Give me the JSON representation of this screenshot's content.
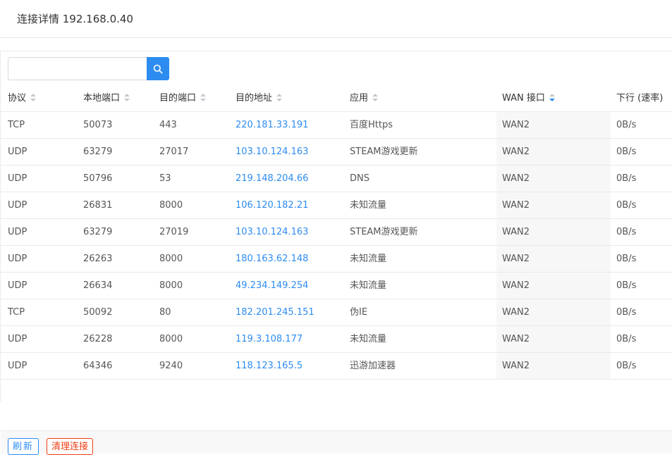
{
  "header": {
    "title": "连接详情 192.168.0.40"
  },
  "search": {
    "placeholder": "",
    "value": "",
    "button_icon": "search-icon"
  },
  "colors": {
    "accent": "#2d8cf0",
    "danger": "#ed3f14"
  },
  "table": {
    "columns": [
      "协议",
      "本地端口",
      "目的端口",
      "目的地址",
      "应用",
      "WAN 接口",
      "下行 (速率)"
    ],
    "sorted_column": "WAN 接口",
    "sort_direction": "descending",
    "rows": [
      [
        "TCP",
        "50073",
        "443",
        "220.181.33.191",
        "百度Https",
        "WAN2",
        "0B/s"
      ],
      [
        "UDP",
        "63279",
        "27017",
        "103.10.124.163",
        "STEAM游戏更新",
        "WAN2",
        "0B/s"
      ],
      [
        "UDP",
        "50796",
        "53",
        "219.148.204.66",
        "DNS",
        "WAN2",
        "0B/s"
      ],
      [
        "UDP",
        "26831",
        "8000",
        "106.120.182.21",
        "未知流量",
        "WAN2",
        "0B/s"
      ],
      [
        "UDP",
        "63279",
        "27019",
        "103.10.124.163",
        "STEAM游戏更新",
        "WAN2",
        "0B/s"
      ],
      [
        "UDP",
        "26263",
        "8000",
        "180.163.62.148",
        "未知流量",
        "WAN2",
        "0B/s"
      ],
      [
        "UDP",
        "26634",
        "8000",
        "49.234.149.254",
        "未知流量",
        "WAN2",
        "0B/s"
      ],
      [
        "TCP",
        "50092",
        "80",
        "182.201.245.151",
        "伪IE",
        "WAN2",
        "0B/s"
      ],
      [
        "UDP",
        "26228",
        "8000",
        "119.3.108.177",
        "未知流量",
        "WAN2",
        "0B/s"
      ],
      [
        "UDP",
        "64346",
        "9240",
        "118.123.165.5",
        "迅游加速器",
        "WAN2",
        "0B/s"
      ]
    ]
  },
  "footer": {
    "refresh_label": "刷新",
    "clear_label": "清理连接"
  }
}
